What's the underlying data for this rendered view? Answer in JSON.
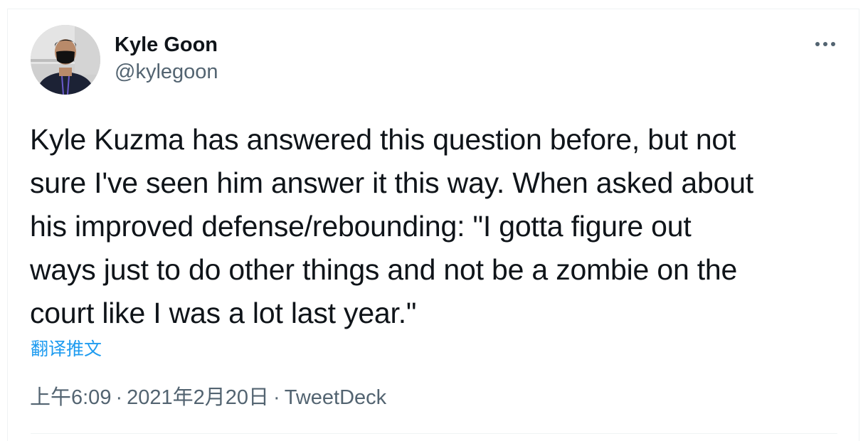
{
  "author": {
    "name": "Kyle Goon",
    "handle": "@kylegoon",
    "avatar_icon": "person-photo"
  },
  "more_menu_icon": "more-dots-icon",
  "tweet": {
    "lines": [
      "Kyle Kuzma has answered this question before, but not",
      "sure I've seen him answer it this way. When asked about",
      "his improved defense/rebounding: \"I gotta figure out",
      "ways just to do other things and not be a zombie on the",
      "court like I was a lot last year.\""
    ]
  },
  "translate_label": "翻译推文",
  "meta": {
    "time": "上午6:09",
    "separator1": "·",
    "date": "2021年2月20日",
    "separator2": "·",
    "source": "TweetDeck"
  },
  "colors": {
    "link": "#1d9bf0",
    "secondary_text": "#536471",
    "primary_text": "#0f1419",
    "border": "#eff3f4"
  }
}
